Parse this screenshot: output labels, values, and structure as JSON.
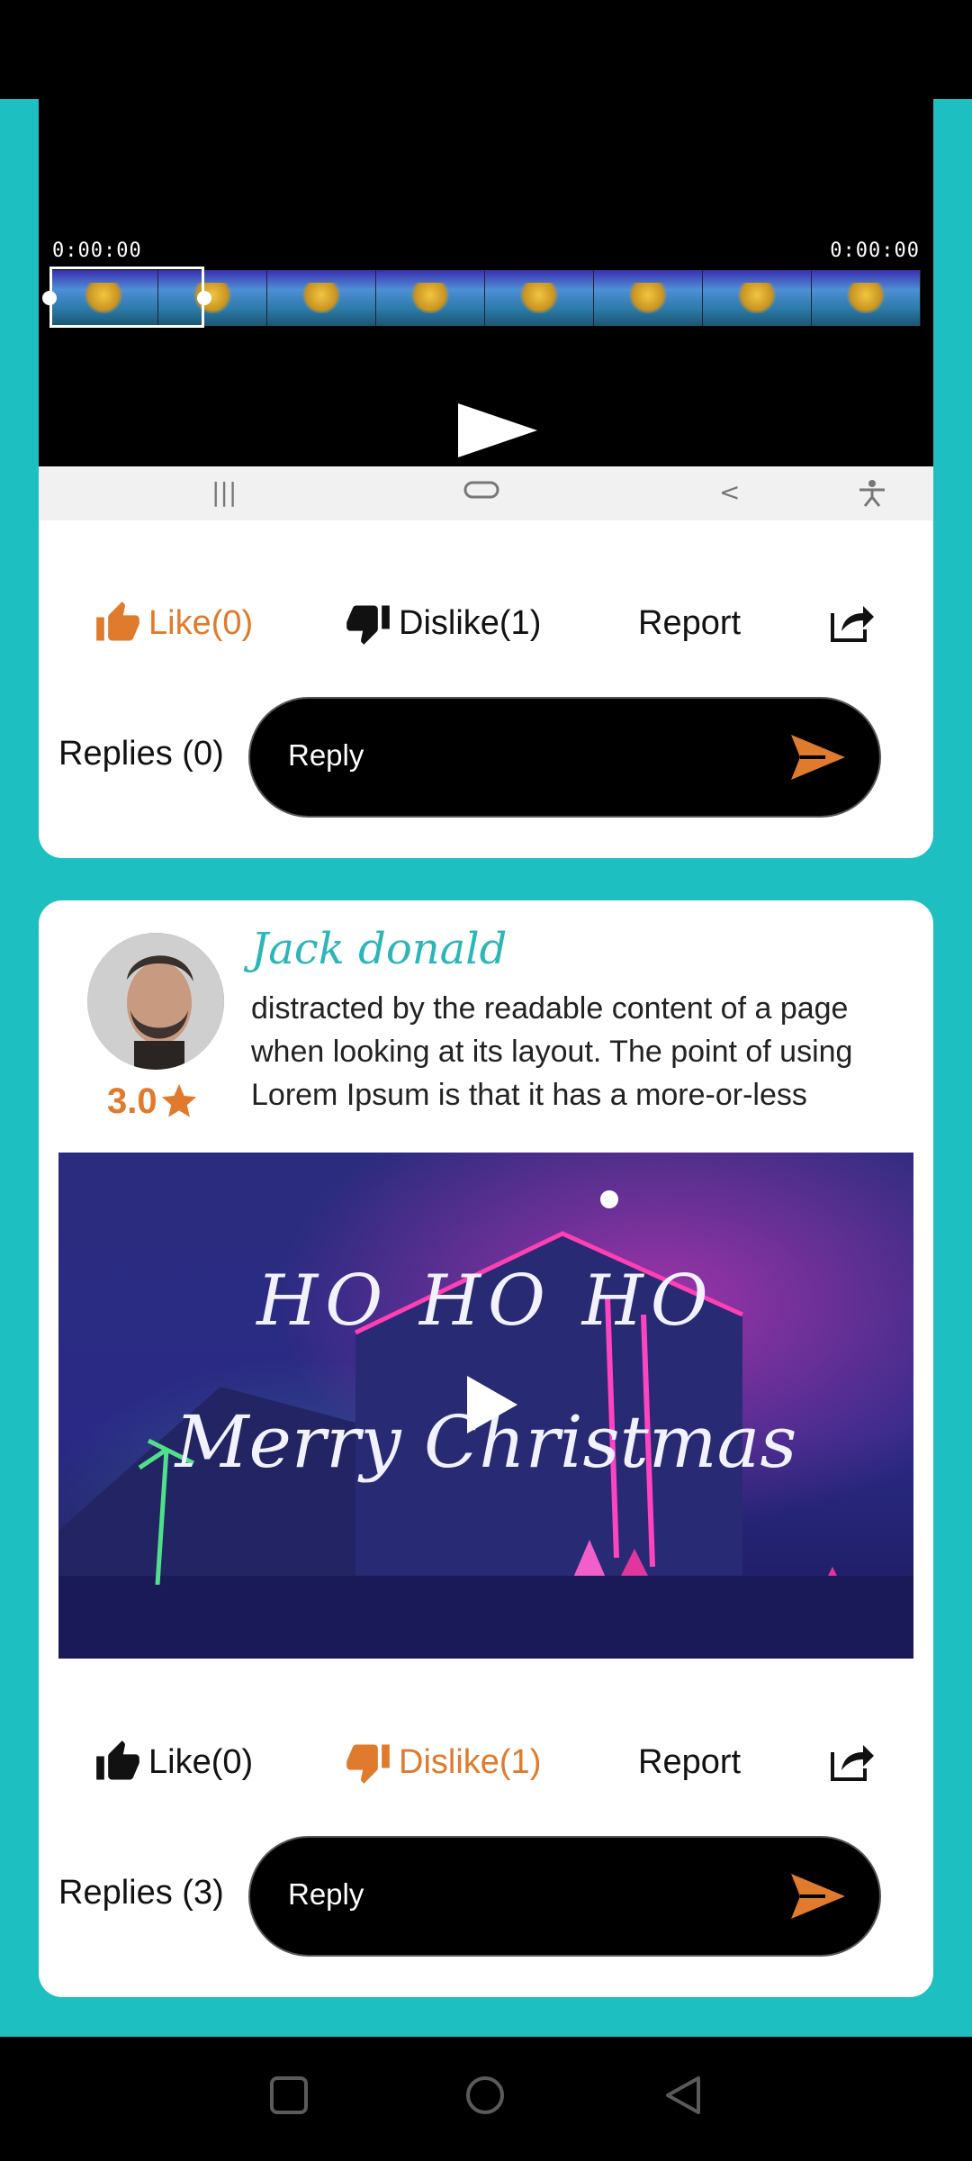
{
  "card1": {
    "player": {
      "time_start": "0:00:00",
      "time_end": "0:00:00",
      "frame_count": 8
    },
    "actions": {
      "like": "Like(0)",
      "dislike": "Dislike(1)",
      "report": "Report",
      "share_icon": "share-icon",
      "like_active": true
    },
    "replies_label": "Replies (0)",
    "reply_placeholder": "Reply"
  },
  "card2": {
    "username": "Jack donald",
    "rating": "3.0",
    "comment": "distracted by the readable content of a page when looking at its layout. The point of using Lorem Ipsum is that it has a more-or-less",
    "video": {
      "line1": "HO HO HO",
      "line2": "Merry Christmas"
    },
    "actions": {
      "like": "Like(0)",
      "dislike": "Dislike(1)",
      "report": "Report",
      "dislike_active": true
    },
    "replies_label": "Replies (3)",
    "reply_placeholder": "Reply"
  },
  "colors": {
    "teal": "#1dbfc0",
    "accent": "#e07a2c",
    "username": "#2bb6b8"
  }
}
